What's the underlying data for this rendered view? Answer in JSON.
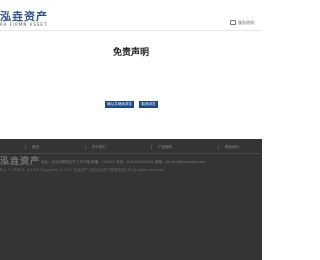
{
  "header": {
    "logo_cn": "泓垚资产",
    "logo_en": "RA FIRMN ASSET",
    "hotline": "服务热线："
  },
  "main": {
    "title": "免责声明",
    "confirm_label": "确认并继续浏览",
    "cancel_label": "取消浏览"
  },
  "footer": {
    "nav": [
      "首页",
      "关于我们",
      "产品服务",
      "联系我们"
    ],
    "logo_cn": "泓垚资产",
    "logo_en": "RA FIRMN ASSET",
    "address": "地址：北京市朝阳区东三环中路 邮编：100022  电话：010-XXXXXXXX  邮箱：service@example.com",
    "copyright": "Copyright © 2017 泓垚资产 北京泓垚资产管理有限公司 All rights reserved"
  }
}
